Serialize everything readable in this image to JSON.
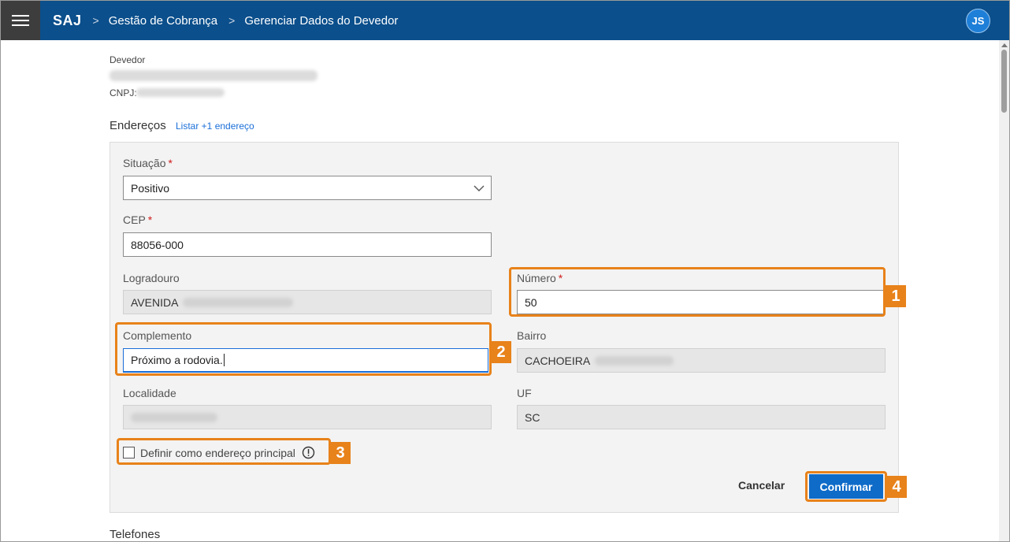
{
  "header": {
    "brand": "SAJ",
    "breadcrumbs": [
      "Gestão de Cobrança",
      "Gerenciar Dados do Devedor"
    ],
    "separator": ">",
    "avatar_initials": "JS"
  },
  "devedor": {
    "label": "Devedor",
    "cnpj_label": "CNPJ:"
  },
  "enderecos": {
    "title": "Endereços",
    "list_link": "Listar +1 endereço"
  },
  "form": {
    "required_mark": "*",
    "situacao": {
      "label": "Situação",
      "value": "Positivo"
    },
    "cep": {
      "label": "CEP",
      "value": "88056-000"
    },
    "logradouro": {
      "label": "Logradouro",
      "value": "AVENIDA"
    },
    "numero": {
      "label": "Número",
      "value": "50"
    },
    "complemento": {
      "label": "Complemento",
      "value": "Próximo a rodovia."
    },
    "bairro": {
      "label": "Bairro",
      "value": "CACHOEIRA"
    },
    "localidade": {
      "label": "Localidade",
      "value": ""
    },
    "uf": {
      "label": "UF",
      "value": "SC"
    },
    "principal_checkbox": {
      "label": "Definir como endereço principal",
      "checked": false
    },
    "cancel_label": "Cancelar",
    "confirm_label": "Confirmar"
  },
  "telefones": {
    "title": "Telefones"
  },
  "annotations": [
    "1",
    "2",
    "3",
    "4"
  ],
  "colors": {
    "topbar": "#0b4f8c",
    "accent": "#e8821a",
    "primary_button": "#0f6bc8",
    "link": "#1a6ed8",
    "required": "#d01b1b"
  }
}
